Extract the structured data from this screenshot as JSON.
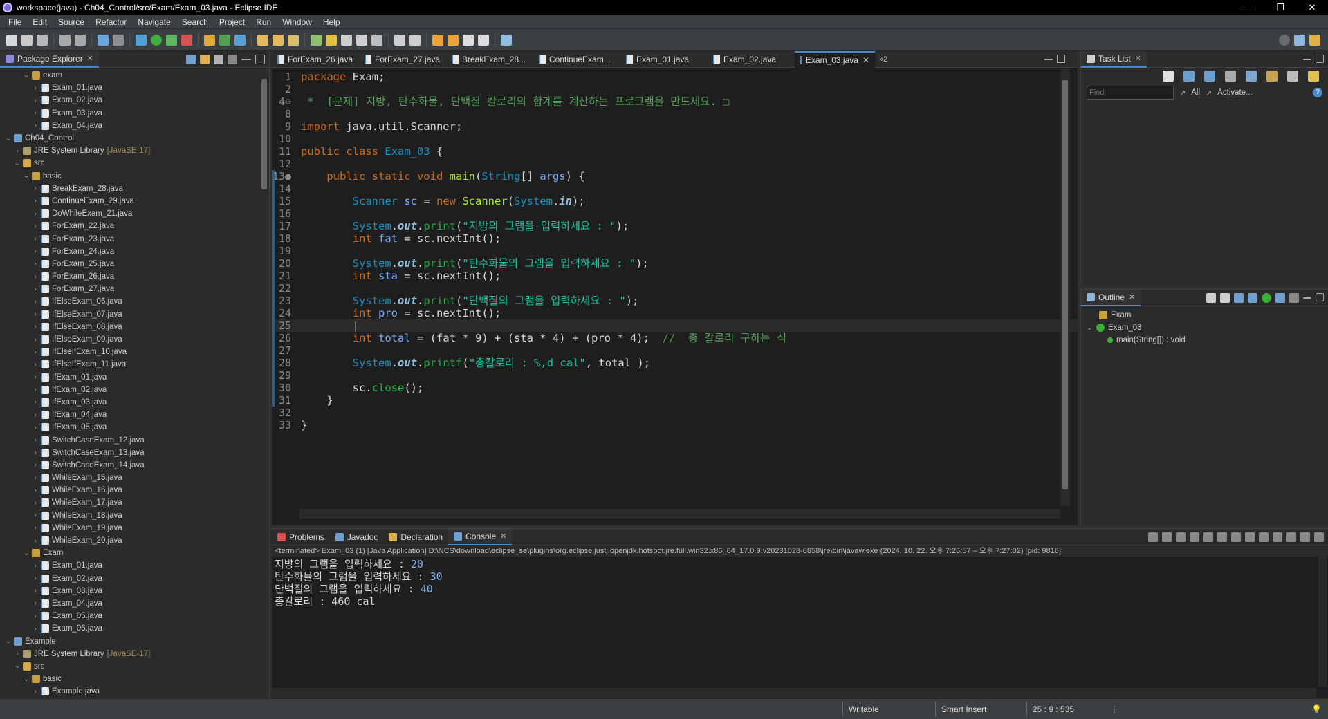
{
  "window": {
    "title": "workspace(java) - Ch04_Control/src/Exam/Exam_03.java - Eclipse IDE"
  },
  "menu": [
    "File",
    "Edit",
    "Source",
    "Refactor",
    "Navigate",
    "Search",
    "Project",
    "Run",
    "Window",
    "Help"
  ],
  "package_explorer": {
    "title": "Package Explorer",
    "rows": [
      {
        "label": "exam",
        "kind": "package",
        "depth": 2,
        "arrow": "⌄"
      },
      {
        "label": "Exam_01.java",
        "kind": "java",
        "depth": 3,
        "arrow": "›"
      },
      {
        "label": "Exam_02.java",
        "kind": "java",
        "depth": 3,
        "arrow": "›"
      },
      {
        "label": "Exam_03.java",
        "kind": "java",
        "depth": 3,
        "arrow": "›"
      },
      {
        "label": "Exam_04.java",
        "kind": "java",
        "depth": 3,
        "arrow": "›"
      },
      {
        "label": "Ch04_Control",
        "kind": "project",
        "depth": 0,
        "arrow": "⌄"
      },
      {
        "label": "JRE System Library",
        "lib": "[JavaSE-17]",
        "kind": "library",
        "depth": 1,
        "arrow": "›"
      },
      {
        "label": "src",
        "kind": "folder",
        "depth": 1,
        "arrow": "⌄"
      },
      {
        "label": "basic",
        "kind": "package",
        "depth": 2,
        "arrow": "⌄"
      },
      {
        "label": "BreakExam_28.java",
        "kind": "java",
        "depth": 3,
        "arrow": "›"
      },
      {
        "label": "ContinueExam_29.java",
        "kind": "java",
        "depth": 3,
        "arrow": "›"
      },
      {
        "label": "DoWhileExam_21.java",
        "kind": "java",
        "depth": 3,
        "arrow": "›"
      },
      {
        "label": "ForExam_22.java",
        "kind": "java",
        "depth": 3,
        "arrow": "›"
      },
      {
        "label": "ForExam_23.java",
        "kind": "java",
        "depth": 3,
        "arrow": "›"
      },
      {
        "label": "ForExam_24.java",
        "kind": "java",
        "depth": 3,
        "arrow": "›"
      },
      {
        "label": "ForExam_25.java",
        "kind": "java",
        "depth": 3,
        "arrow": "›"
      },
      {
        "label": "ForExam_26.java",
        "kind": "java",
        "depth": 3,
        "arrow": "›"
      },
      {
        "label": "ForExam_27.java",
        "kind": "java",
        "depth": 3,
        "arrow": "›"
      },
      {
        "label": "IfElseExam_06.java",
        "kind": "java",
        "depth": 3,
        "arrow": "›"
      },
      {
        "label": "IfElseExam_07.java",
        "kind": "java",
        "depth": 3,
        "arrow": "›"
      },
      {
        "label": "IfElseExam_08.java",
        "kind": "java",
        "depth": 3,
        "arrow": "›"
      },
      {
        "label": "IfElseExam_09.java",
        "kind": "java",
        "depth": 3,
        "arrow": "›"
      },
      {
        "label": "IfElseIfExam_10.java",
        "kind": "java",
        "depth": 3,
        "arrow": "›"
      },
      {
        "label": "IfElseIfExam_11.java",
        "kind": "java",
        "depth": 3,
        "arrow": "›"
      },
      {
        "label": "IfExam_01.java",
        "kind": "java",
        "depth": 3,
        "arrow": "›"
      },
      {
        "label": "IfExam_02.java",
        "kind": "java",
        "depth": 3,
        "arrow": "›"
      },
      {
        "label": "IfExam_03.java",
        "kind": "java",
        "depth": 3,
        "arrow": "›"
      },
      {
        "label": "IfExam_04.java",
        "kind": "java",
        "depth": 3,
        "arrow": "›"
      },
      {
        "label": "IfExam_05.java",
        "kind": "java",
        "depth": 3,
        "arrow": "›"
      },
      {
        "label": "SwitchCaseExam_12.java",
        "kind": "java",
        "depth": 3,
        "arrow": "›"
      },
      {
        "label": "SwitchCaseExam_13.java",
        "kind": "java",
        "depth": 3,
        "arrow": "›"
      },
      {
        "label": "SwitchCaseExam_14.java",
        "kind": "java",
        "depth": 3,
        "arrow": "›"
      },
      {
        "label": "WhileExam_15.java",
        "kind": "java",
        "depth": 3,
        "arrow": "›"
      },
      {
        "label": "WhileExam_16.java",
        "kind": "java",
        "depth": 3,
        "arrow": "›"
      },
      {
        "label": "WhileExam_17.java",
        "kind": "java",
        "depth": 3,
        "arrow": "›"
      },
      {
        "label": "WhileExam_18.java",
        "kind": "java",
        "depth": 3,
        "arrow": "›"
      },
      {
        "label": "WhileExam_19.java",
        "kind": "java",
        "depth": 3,
        "arrow": "›"
      },
      {
        "label": "WhileExam_20.java",
        "kind": "java",
        "depth": 3,
        "arrow": "›"
      },
      {
        "label": "Exam",
        "kind": "package",
        "depth": 2,
        "arrow": "⌄"
      },
      {
        "label": "Exam_01.java",
        "kind": "java",
        "depth": 3,
        "arrow": "›"
      },
      {
        "label": "Exam_02.java",
        "kind": "java",
        "depth": 3,
        "arrow": "›"
      },
      {
        "label": "Exam_03.java",
        "kind": "java",
        "depth": 3,
        "arrow": "›"
      },
      {
        "label": "Exam_04.java",
        "kind": "java",
        "depth": 3,
        "arrow": "›"
      },
      {
        "label": "Exam_05.java",
        "kind": "java",
        "depth": 3,
        "arrow": "›"
      },
      {
        "label": "Exam_06.java",
        "kind": "java",
        "depth": 3,
        "arrow": "›"
      },
      {
        "label": "Example",
        "kind": "project",
        "depth": 0,
        "arrow": "⌄"
      },
      {
        "label": "JRE System Library",
        "lib": "[JavaSE-17]",
        "kind": "library",
        "depth": 1,
        "arrow": "›"
      },
      {
        "label": "src",
        "kind": "folder",
        "depth": 1,
        "arrow": "⌄"
      },
      {
        "label": "basic",
        "kind": "package",
        "depth": 2,
        "arrow": "⌄"
      },
      {
        "label": "Example.java",
        "kind": "java",
        "depth": 3,
        "arrow": "›"
      }
    ]
  },
  "editor": {
    "tabs": [
      {
        "label": "ForExam_26.java",
        "active": false
      },
      {
        "label": "ForExam_27.java",
        "active": false
      },
      {
        "label": "BreakExam_28...",
        "active": false
      },
      {
        "label": "ContinueExam...",
        "active": false
      },
      {
        "label": "Exam_01.java",
        "active": false
      },
      {
        "label": "Exam_02.java",
        "active": false
      },
      {
        "label": "Exam_03.java",
        "active": true
      }
    ],
    "overflow": "»2",
    "current_line": "25",
    "lines": [
      {
        "n": "1",
        "t": [
          [
            "kw",
            "package"
          ],
          [
            "ctext",
            " Exam;"
          ]
        ]
      },
      {
        "n": "2",
        "t": []
      },
      {
        "n": "4⊕",
        "t": [
          [
            "cmt",
            " *  [문제] 지방, 탄수화물, 단백질 칼로리의 합계를 계산하는 프로그램을 만드세요. □"
          ]
        ]
      },
      {
        "n": "8",
        "t": []
      },
      {
        "n": "9",
        "t": [
          [
            "kw",
            "import"
          ],
          [
            "ctext",
            " java.util.Scanner;"
          ]
        ]
      },
      {
        "n": "10",
        "t": []
      },
      {
        "n": "11",
        "t": [
          [
            "kw",
            "public class"
          ],
          [
            "ctext",
            " "
          ],
          [
            "cls",
            "Exam_03"
          ],
          [
            "ctext",
            " {"
          ]
        ]
      },
      {
        "n": "12",
        "t": []
      },
      {
        "n": "13●",
        "t": [
          [
            "ctext",
            "    "
          ],
          [
            "kw",
            "public static void"
          ],
          [
            "ctext",
            " "
          ],
          [
            "fn",
            "main"
          ],
          [
            "ctext",
            "("
          ],
          [
            "cls",
            "String"
          ],
          [
            "ctext",
            "[] "
          ],
          [
            "var",
            "args"
          ],
          [
            "ctext",
            ") {"
          ]
        ]
      },
      {
        "n": "14",
        "t": []
      },
      {
        "n": "15",
        "t": [
          [
            "ctext",
            "        "
          ],
          [
            "cls",
            "Scanner"
          ],
          [
            "ctext",
            " "
          ],
          [
            "var",
            "sc"
          ],
          [
            "ctext",
            " = "
          ],
          [
            "kw",
            "new"
          ],
          [
            "ctext",
            " "
          ],
          [
            "fn",
            "Scanner"
          ],
          [
            "ctext",
            "("
          ],
          [
            "cls",
            "System"
          ],
          [
            "ctext",
            "."
          ],
          [
            "fld",
            "in"
          ],
          [
            "ctext",
            ");"
          ]
        ]
      },
      {
        "n": "16",
        "t": []
      },
      {
        "n": "17",
        "t": [
          [
            "ctext",
            "        "
          ],
          [
            "cls",
            "System"
          ],
          [
            "ctext",
            "."
          ],
          [
            "fld",
            "out"
          ],
          [
            "ctext",
            "."
          ],
          [
            "mth",
            "print"
          ],
          [
            "ctext",
            "("
          ],
          [
            "str",
            "\"지방의 그램을 입력하세요 : \""
          ],
          [
            "ctext",
            ");"
          ]
        ]
      },
      {
        "n": "18",
        "t": [
          [
            "ctext",
            "        "
          ],
          [
            "kw",
            "int"
          ],
          [
            "ctext",
            " "
          ],
          [
            "var",
            "fat"
          ],
          [
            "ctext",
            " = sc.nextInt();"
          ]
        ]
      },
      {
        "n": "19",
        "t": []
      },
      {
        "n": "20",
        "t": [
          [
            "ctext",
            "        "
          ],
          [
            "cls",
            "System"
          ],
          [
            "ctext",
            "."
          ],
          [
            "fld",
            "out"
          ],
          [
            "ctext",
            "."
          ],
          [
            "mth",
            "print"
          ],
          [
            "ctext",
            "("
          ],
          [
            "str",
            "\"탄수화물의 그램을 입력하세요 : \""
          ],
          [
            "ctext",
            ");"
          ]
        ]
      },
      {
        "n": "21",
        "t": [
          [
            "ctext",
            "        "
          ],
          [
            "kw",
            "int"
          ],
          [
            "ctext",
            " "
          ],
          [
            "var",
            "sta"
          ],
          [
            "ctext",
            " = sc.nextInt();"
          ]
        ]
      },
      {
        "n": "22",
        "t": []
      },
      {
        "n": "23",
        "t": [
          [
            "ctext",
            "        "
          ],
          [
            "cls",
            "System"
          ],
          [
            "ctext",
            "."
          ],
          [
            "fld",
            "out"
          ],
          [
            "ctext",
            "."
          ],
          [
            "mth",
            "print"
          ],
          [
            "ctext",
            "("
          ],
          [
            "str",
            "\"단백질의 그램을 입력하세요 : \""
          ],
          [
            "ctext",
            ");"
          ]
        ]
      },
      {
        "n": "24",
        "t": [
          [
            "ctext",
            "        "
          ],
          [
            "kw",
            "int"
          ],
          [
            "ctext",
            " "
          ],
          [
            "var",
            "pro"
          ],
          [
            "ctext",
            " = sc.nextInt();"
          ]
        ]
      },
      {
        "n": "25",
        "t": [
          [
            "ctext",
            "        |"
          ]
        ]
      },
      {
        "n": "26",
        "t": [
          [
            "ctext",
            "        "
          ],
          [
            "kw",
            "int"
          ],
          [
            "ctext",
            " "
          ],
          [
            "var",
            "total"
          ],
          [
            "ctext",
            " = (fat * 9) + (sta * 4) + (pro * 4);  "
          ],
          [
            "cmt",
            "//  총 칼로리 구하는 식"
          ]
        ]
      },
      {
        "n": "27",
        "t": []
      },
      {
        "n": "28",
        "t": [
          [
            "ctext",
            "        "
          ],
          [
            "cls",
            "System"
          ],
          [
            "ctext",
            "."
          ],
          [
            "fld",
            "out"
          ],
          [
            "ctext",
            "."
          ],
          [
            "mth",
            "printf"
          ],
          [
            "ctext",
            "("
          ],
          [
            "str",
            "\"총칼로리 : %,d cal\""
          ],
          [
            "ctext",
            ", total );"
          ]
        ]
      },
      {
        "n": "29",
        "t": []
      },
      {
        "n": "30",
        "t": [
          [
            "ctext",
            "        sc."
          ],
          [
            "mth",
            "close"
          ],
          [
            "ctext",
            "();"
          ]
        ]
      },
      {
        "n": "31",
        "t": [
          [
            "ctext",
            "    }"
          ]
        ]
      },
      {
        "n": "32",
        "t": []
      },
      {
        "n": "33",
        "t": [
          [
            "ctext",
            "}"
          ]
        ]
      }
    ]
  },
  "task_list": {
    "title": "Task List",
    "find_placeholder": "Find",
    "all_label": "All",
    "activate_label": "Activate..."
  },
  "outline": {
    "title": "Outline",
    "items": [
      {
        "label": "Exam",
        "depth": 0
      },
      {
        "label": "Exam_03",
        "depth": 0
      },
      {
        "label": "main(String[]) : void",
        "depth": 1
      }
    ]
  },
  "bottom_tabs": [
    {
      "label": "Problems",
      "active": false
    },
    {
      "label": "Javadoc",
      "active": false
    },
    {
      "label": "Declaration",
      "active": false
    },
    {
      "label": "Console",
      "active": true
    }
  ],
  "console": {
    "header": "<terminated> Exam_03 (1) [Java Application] D:\\NCS\\download\\eclipse_se\\plugins\\org.eclipse.justj.openjdk.hotspot.jre.full.win32.x86_64_17.0.9.v20231028-0858\\jre\\bin\\javaw.exe  (2024. 10. 22. 오후 7:26:57 – 오후 7:27:02) [pid: 9816]",
    "lines": [
      {
        "prompt": "지방의 그램을 입력하세요 : ",
        "input": "20"
      },
      {
        "prompt": "탄수화물의 그램을 입력하세요 : ",
        "input": "30"
      },
      {
        "prompt": "단백질의 그램을 입력하세요 : ",
        "input": "40"
      },
      {
        "prompt": "총칼로리 : 460 cal",
        "input": ""
      }
    ]
  },
  "status": {
    "writable": "Writable",
    "insert_mode": "Smart Insert",
    "position": "25 : 9 : 535"
  },
  "colors": {
    "accent": "#4a88c7",
    "keyword": "#cc6c1d",
    "string": "#17c6a3",
    "comment": "#56a25b"
  }
}
